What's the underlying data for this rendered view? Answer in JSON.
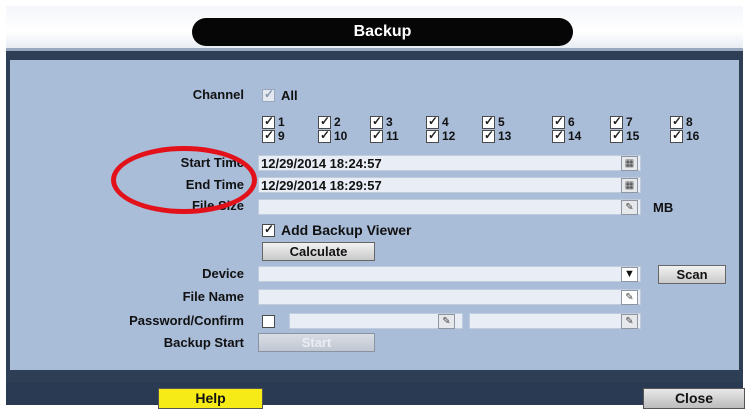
{
  "window": {
    "title": "Backup"
  },
  "channel": {
    "label": "Channel",
    "all_label": "All",
    "all_checked": true,
    "items": [
      "1",
      "2",
      "3",
      "4",
      "5",
      "6",
      "7",
      "8",
      "9",
      "10",
      "11",
      "12",
      "13",
      "14",
      "15",
      "16"
    ]
  },
  "start_time": {
    "label": "Start Time",
    "value": "12/29/2014 18:24:57",
    "icon": "calendar-icon"
  },
  "end_time": {
    "label": "End Time",
    "value": "12/29/2014 18:29:57",
    "icon": "calendar-icon"
  },
  "file_size": {
    "label": "File Size",
    "value": "",
    "unit": "MB",
    "icon": "pencil-icon"
  },
  "add_backup_viewer": {
    "label": "Add Backup Viewer",
    "checked": true
  },
  "calculate_button": "Calculate",
  "device": {
    "label": "Device",
    "value": "",
    "dropdown_icon": "chevron-down-icon",
    "scan_button": "Scan"
  },
  "file_name": {
    "label": "File Name",
    "value": "",
    "icon": "pencil-icon"
  },
  "password": {
    "label": "Password/Confirm",
    "checked": false,
    "password_value": "",
    "confirm_value": "",
    "icon": "pencil-icon"
  },
  "backup_start": {
    "label": "Backup Start",
    "button": "Start"
  },
  "footer": {
    "help": "Help",
    "close": "Close"
  },
  "annotation": {
    "shape": "ellipse",
    "color": "#e3121a"
  }
}
